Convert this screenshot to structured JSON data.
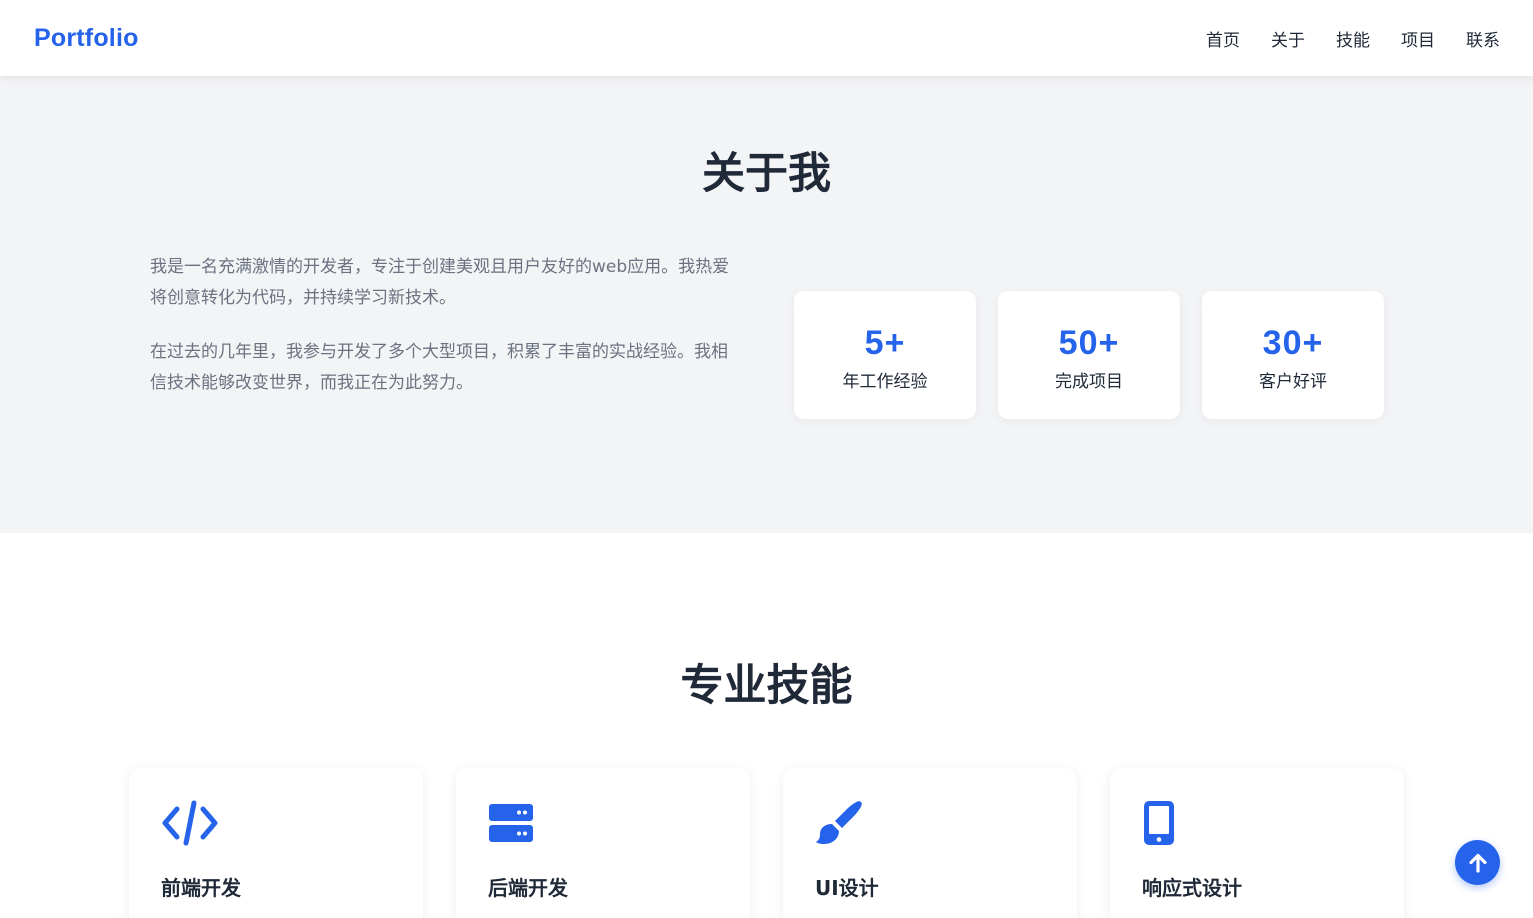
{
  "colors": {
    "accent": "#2563eb",
    "section_bg": "#f3f4f6",
    "text_dark": "#1f2937",
    "text_muted": "#6b7280"
  },
  "navbar": {
    "logo": "Portfolio",
    "links": [
      {
        "label": "首页"
      },
      {
        "label": "关于"
      },
      {
        "label": "技能"
      },
      {
        "label": "项目"
      },
      {
        "label": "联系"
      }
    ]
  },
  "about": {
    "title": "关于我",
    "paragraphs": [
      "我是一名充满激情的开发者，专注于创建美观且用户友好的web应用。我热爱将创意转化为代码，并持续学习新技术。",
      "在过去的几年里，我参与开发了多个大型项目，积累了丰富的实战经验。我相信技术能够改变世界，而我正在为此努力。"
    ],
    "stats": [
      {
        "value": "5+",
        "label": "年工作经验"
      },
      {
        "value": "50+",
        "label": "完成项目"
      },
      {
        "value": "30+",
        "label": "客户好评"
      }
    ]
  },
  "skills": {
    "title": "专业技能",
    "items": [
      {
        "icon": "code-icon",
        "title": "前端开发"
      },
      {
        "icon": "server-icon",
        "title": "后端开发"
      },
      {
        "icon": "paintbrush-icon",
        "title": "UI设计"
      },
      {
        "icon": "mobile-icon",
        "title": "响应式设计"
      }
    ]
  },
  "back_to_top": {
    "icon": "arrow-up-icon"
  }
}
